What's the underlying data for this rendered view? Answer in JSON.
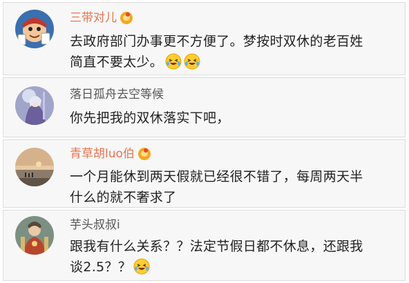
{
  "comments": [
    {
      "username": "三带对儿",
      "has_vip_badge": true,
      "avatar_icon": "cartoon-card-player-avatar",
      "text_line1": "去政府部门办事更不方便了。梦按时双休的老百姓",
      "text_line2": "简直不要太少。",
      "emojis": [
        "laugh-cry-emoji",
        "laugh-cry-emoji"
      ]
    },
    {
      "username": "落日孤舟去空等候",
      "has_vip_badge": false,
      "avatar_icon": "anime-character-avatar",
      "text_line1": "你先把我的双休落实下吧，"
    },
    {
      "username": "青草胡luo伯",
      "has_vip_badge": true,
      "avatar_icon": "sunset-lake-avatar",
      "text_line1": "一个月能休到两天假就已经很不错了，每周两天半",
      "text_line2": "什么的就不奢求了"
    },
    {
      "username": "芋头叔叔i",
      "has_vip_badge": false,
      "avatar_icon": "fantasy-warrior-avatar",
      "text_line1": "跟我有什么关系？？法定节假日都不休息，还跟我",
      "text_line2": "谈2.5？？",
      "emojis": [
        "laugh-cry-emoji"
      ]
    }
  ],
  "colors": {
    "vip_name": "#eb7350",
    "plain_name": "#555555",
    "card_background": "#f7f7f7",
    "text": "#222222"
  }
}
